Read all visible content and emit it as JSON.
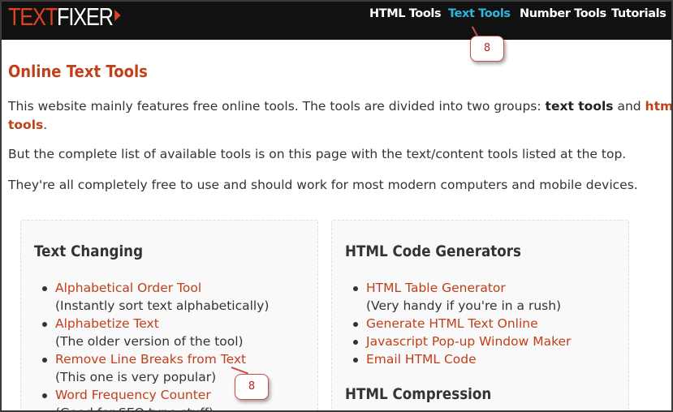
{
  "logo": {
    "part1": "TEXT",
    "part2": "FIXER"
  },
  "nav": {
    "html_tools": "HTML Tools",
    "text_tools": "Text Tools",
    "number_tools": "Number Tools",
    "tutorials": "Tutorials"
  },
  "callouts": {
    "nav": "8",
    "tool": "8"
  },
  "page": {
    "title": "Online Text Tools",
    "intro_part1": "This website mainly features free online tools. The tools are divided into two groups: ",
    "intro_text_tools": "text tools",
    "intro_and": " and ",
    "intro_html": "html",
    "intro_tools": "tools",
    "intro_period": ".",
    "para2": "But the complete list of available tools is on this page with the text/content tools listed at the top.",
    "para3": "They're all completely free to use and should work for most modern computers and mobile devices."
  },
  "text_changing": {
    "title": "Text Changing",
    "items": [
      {
        "label": "Alphabetical Order Tool",
        "desc": "(Instantly sort text alphabetically)"
      },
      {
        "label": "Alphabetize Text",
        "desc": "(The older version of the tool)"
      },
      {
        "label": "Remove Line Breaks from Text",
        "desc": "(This one is very popular)"
      },
      {
        "label": "Word Frequency Counter",
        "desc": "(Good for SEO type stuff)"
      }
    ]
  },
  "html_generators": {
    "title": "HTML Code Generators",
    "items": [
      {
        "label": "HTML Table Generator",
        "desc": "(Very handy if you're in a rush)"
      },
      {
        "label": "Generate HTML Text Online"
      },
      {
        "label": "Javascript Pop-up Window Maker"
      },
      {
        "label": "Email HTML Code"
      }
    ]
  },
  "html_compression": {
    "title": "HTML Compression"
  },
  "colors": {
    "accent": "#c0401b",
    "nav_active": "#2fb5e0",
    "navbar_bg": "#111111",
    "callout_border": "#d04a4a"
  }
}
